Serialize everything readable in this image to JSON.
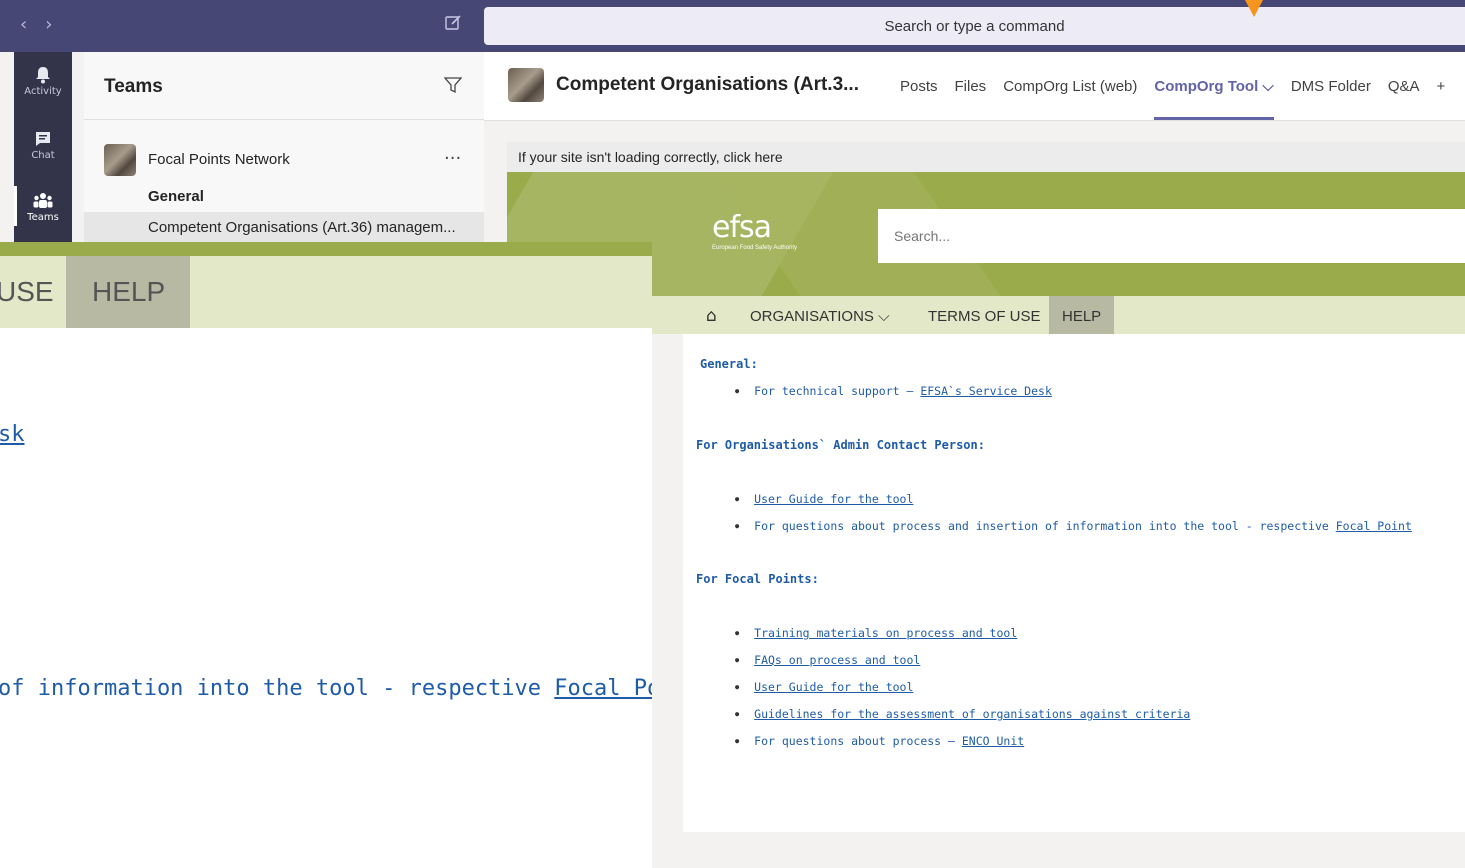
{
  "topbar": {
    "search_placeholder": "Search or type a command",
    "back_glyph": "‹",
    "forward_glyph": "›"
  },
  "rail": {
    "items": [
      {
        "label": "Activity"
      },
      {
        "label": "Chat"
      },
      {
        "label": "Teams"
      }
    ]
  },
  "teamlist": {
    "title": "Teams",
    "team_name": "Focal Points Network",
    "more": "···",
    "channel_general": "General",
    "channel_active": "Competent Organisations (Art.36) managem..."
  },
  "channel": {
    "title": "Competent Organisations (Art.3...",
    "tabs": [
      {
        "label": "Posts"
      },
      {
        "label": "Files"
      },
      {
        "label": "CompOrg List (web)"
      },
      {
        "label": "CompOrg Tool ⌵"
      },
      {
        "label": "DMS Folder"
      },
      {
        "label": "Q&A"
      },
      {
        "label": "+"
      }
    ]
  },
  "sharepoint": {
    "loading_notice": "If your site isn't loading correctly, click here",
    "logo_word": "efsa",
    "logo_sub": "European Food Safety Authority",
    "search_placeholder": "Search...",
    "nav": {
      "home_glyph": "⌂",
      "organisations": "ORGANISATIONS ⌵",
      "terms": "TERMS OF USE",
      "help": "HELP"
    },
    "sections": {
      "general": {
        "title": "General:",
        "items": [
          {
            "prefix": "For technical support – ",
            "link": "EFSA`s Service Desk"
          }
        ]
      },
      "admin": {
        "title": "For Organisations` Admin Contact Person:",
        "items": [
          {
            "link": "User Guide for the tool"
          },
          {
            "prefix": "For questions about process and insertion of information into the tool - respective ",
            "link": "Focal Point"
          }
        ]
      },
      "focal": {
        "title": "For Focal Points:",
        "items": [
          {
            "link": "Training materials on process and tool"
          },
          {
            "link": "FAQs on process and tool"
          },
          {
            "link": "User Guide for the tool"
          },
          {
            "link": "Guidelines for the assessment of organisations against criteria"
          },
          {
            "prefix": "For questions about process – ",
            "link": "ENCO Unit"
          }
        ]
      }
    }
  },
  "zoom": {
    "nav_use": "USE",
    "nav_help": "HELP",
    "line1_link": "sk",
    "line2_prefix": "of information into the tool - respective ",
    "line2_link": "Focal Point"
  },
  "colors": {
    "teams_purple": "#464775",
    "teams_accent": "#6264a7",
    "efsa_green": "#9aab4c",
    "nav_green": "#e2e8c8",
    "link_blue": "#1f5ca8",
    "pointer_orange": "#f7941d"
  }
}
